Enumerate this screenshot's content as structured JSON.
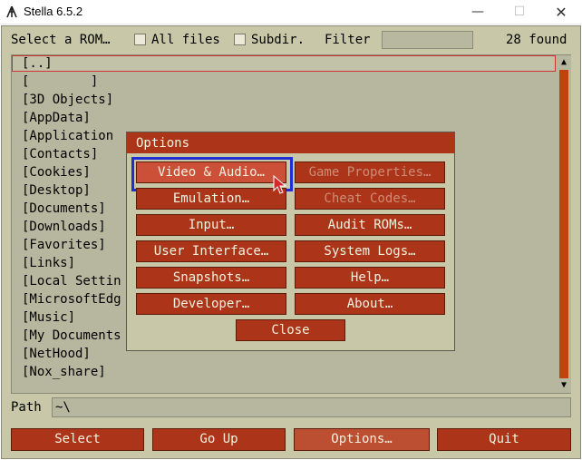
{
  "window": {
    "title": "Stella 6.5.2",
    "min_glyph": "—",
    "max_glyph": "☐",
    "close_glyph": "✕"
  },
  "toolbar": {
    "select_rom_label": "Select a ROM…",
    "all_files_label": "All files",
    "subdir_label": "Subdir.",
    "filter_label": "Filter",
    "filter_value": "",
    "found_count": "28 found"
  },
  "file_list": {
    "items": [
      "[..]",
      "[        ]",
      "[3D Objects]",
      "[AppData]",
      "[Application",
      "[Contacts]",
      "[Cookies]",
      "[Desktop]",
      "[Documents]",
      "[Downloads]",
      "[Favorites]",
      "[Links]",
      "[Local Settin",
      "[MicrosoftEdg",
      "[Music]",
      "[My Documents",
      "[NetHood]",
      "[Nox_share]"
    ]
  },
  "path": {
    "label": "Path",
    "value": "~\\"
  },
  "bottom_buttons": {
    "select": "Select",
    "go_up": "Go Up",
    "options": "Options…",
    "quit": "Quit"
  },
  "options_dialog": {
    "title": "Options",
    "buttons": {
      "video_audio": "Video & Audio…",
      "game_properties": "Game Properties…",
      "emulation": "Emulation…",
      "cheat_codes": "Cheat Codes…",
      "input": "Input…",
      "audit_roms": "Audit ROMs…",
      "user_interface": "User Interface…",
      "system_logs": "System Logs…",
      "snapshots": "Snapshots…",
      "help": "Help…",
      "developer": "Developer…",
      "about": "About…",
      "close": "Close"
    }
  },
  "colors": {
    "background": "#c8c8a8",
    "button": "#ac3418",
    "button_highlight": "#cc5038",
    "focus_ring": "#1f2fd0"
  },
  "icons": {
    "app": "stella-logo-icon",
    "cursor": "mouse-pointer-icon"
  }
}
